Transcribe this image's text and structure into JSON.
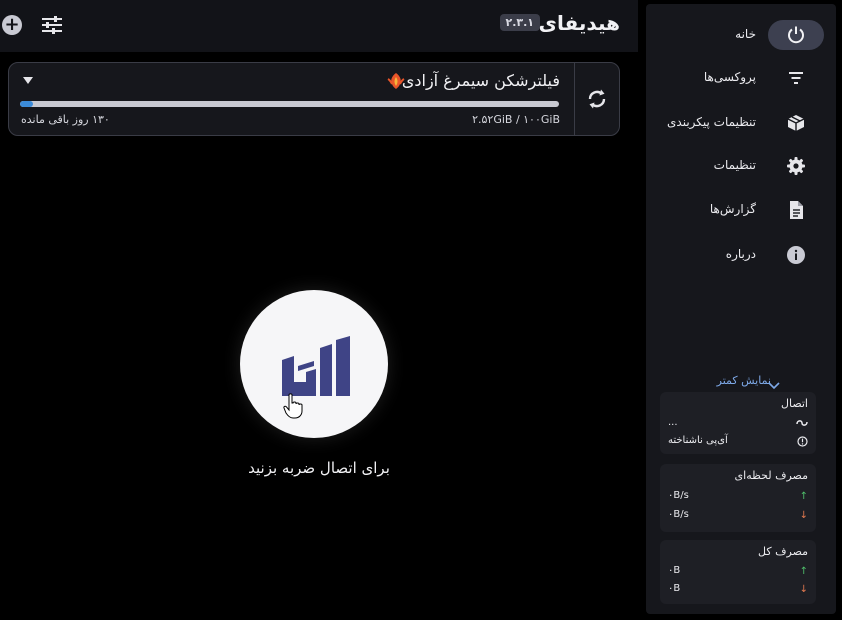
{
  "header": {
    "title": "هیدیفای",
    "version": "۲.۳.۱"
  },
  "profile": {
    "name": "فیلترشکن سیمرغ آزادی",
    "usage": "۲.۵۲GiB / ۱۰۰GiB",
    "usage_fraction": 0.025,
    "days_left": "۱۳۰ روز باقی مانده"
  },
  "connect": {
    "hint": "برای اتصال ضربه بزنید"
  },
  "sidebar": {
    "items": [
      {
        "label": "خانه",
        "icon": "power-icon"
      },
      {
        "label": "پروکسی‌ها",
        "icon": "filter-icon"
      },
      {
        "label": "تنظیمات پیکربندی",
        "icon": "package-icon"
      },
      {
        "label": "تنظیمات",
        "icon": "gear-icon"
      },
      {
        "label": "گزارش‌ها",
        "icon": "document-icon"
      },
      {
        "label": "درباره",
        "icon": "info-icon"
      }
    ],
    "show_less": "نمایش کمتر"
  },
  "stats": {
    "connection": {
      "title": "اتصال",
      "value": "...",
      "ip": "آی‌پی ناشناخته"
    },
    "speed": {
      "title": "مصرف لحظه‌ای",
      "up": "۰B/s",
      "down": "۰B/s"
    },
    "total": {
      "title": "مصرف کل",
      "up": "۰B",
      "down": "۰B"
    }
  },
  "colors": {
    "accent": "#3b8bd9",
    "active_nav": "#3d4050",
    "logo": "#3f4486"
  }
}
